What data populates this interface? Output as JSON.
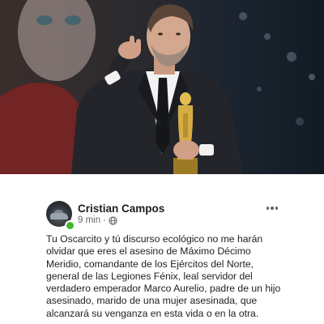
{
  "post": {
    "author": "Cristian Campos",
    "time": "9 min",
    "separator": "·",
    "lines": [
      "Tu Oscarcito y tú discurso ecológico no me harán",
      "olvidar que eres el asesino de Máximo Décimo",
      "Meridio, comandante de los Ejércitos del Norte,",
      "general de las Legiones Fénix, leal servidor del",
      "verdadero emperador Marco Aurelio, padre de un hijo",
      "asesinado, marido de una mujer asesinada, que",
      "alcanzará su venganza en esta vida o en la otra."
    ]
  },
  "icons": {
    "privacy": "globe-icon",
    "menu": "more-horizontal-icon"
  },
  "colors": {
    "name": "#1c1e21",
    "meta": "#65676b",
    "online": "#42b72a",
    "oscar_gold": "#c9a23a"
  }
}
